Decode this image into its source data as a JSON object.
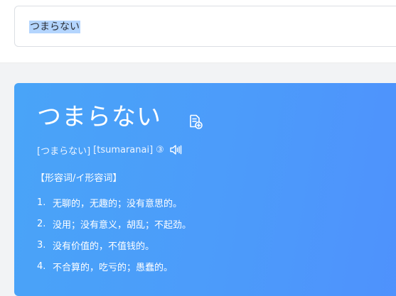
{
  "search": {
    "query": "つまらない"
  },
  "entry": {
    "word": "つまらない",
    "reading": "[つまらない]",
    "romaji": "[tsumaranai]",
    "accent": "③",
    "part_of_speech": "【形容词/イ形容词】",
    "definitions": [
      {
        "num": "1.",
        "text": "无聊的，无趣的；没有意思的。"
      },
      {
        "num": "2.",
        "text": "没用；没有意义，胡乱；不起劲。"
      },
      {
        "num": "3.",
        "text": "没有价值的，不值钱的。"
      },
      {
        "num": "4.",
        "text": "不合算的，吃亏的；愚蠢的。"
      }
    ]
  },
  "icons": {
    "add": "add-to-wordbook-icon",
    "audio": "speaker-icon"
  },
  "colors": {
    "card_gradient_start": "#49a4f8",
    "card_gradient_end": "#4f91fd",
    "selection": "#b4d5fe"
  }
}
